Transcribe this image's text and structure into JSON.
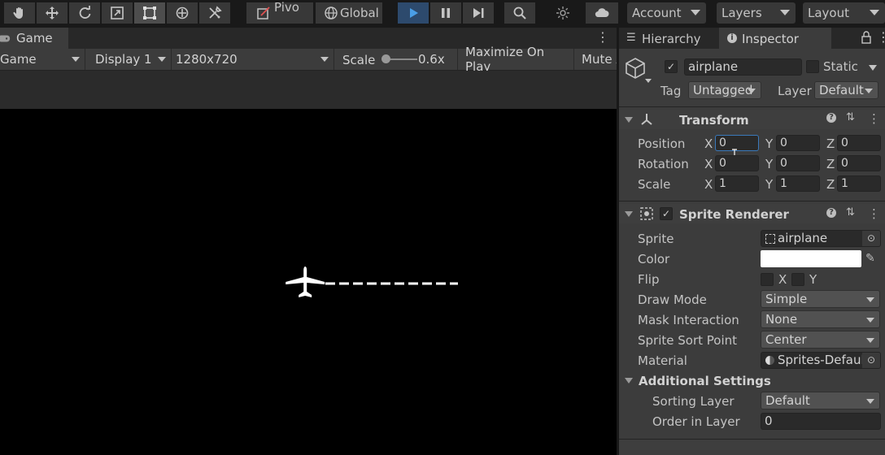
{
  "toolbar": {
    "tools": [
      "hand-tool",
      "move-tool",
      "rotate-tool",
      "scale-tool",
      "rect-tool",
      "transform-tool",
      "custom-tool"
    ],
    "pivot_label": "Pivo",
    "global_label": "Global",
    "account_label": "Account",
    "layers_label": "Layers",
    "layout_label": "Layout"
  },
  "game": {
    "tab_label": "Game",
    "view_mode": "Game",
    "display": "Display 1",
    "resolution": "1280x720",
    "scale_label": "Scale",
    "scale_value": "0.6x",
    "maximize_label": "Maximize On Play",
    "mute_label": "Mute A"
  },
  "inspector": {
    "hierarchy_tab": "Hierarchy",
    "inspector_tab": "Inspector",
    "object_name": "airplane",
    "static_label": "Static",
    "tag_label": "Tag",
    "tag_value": "Untagged",
    "layer_label": "Layer",
    "layer_value": "Default",
    "transform": {
      "title": "Transform",
      "position_label": "Position",
      "rotation_label": "Rotation",
      "scale_label": "Scale",
      "axis_x": "X",
      "axis_y": "Y",
      "axis_z": "Z",
      "position": [
        "0",
        "0",
        "0"
      ],
      "rotation": [
        "0",
        "0",
        "0"
      ],
      "scale": [
        "1",
        "1",
        "1"
      ]
    },
    "sprite_renderer": {
      "title": "Sprite Renderer",
      "sprite_label": "Sprite",
      "sprite_value": "airplane",
      "color_label": "Color",
      "color_value": "#ffffff",
      "flip_label": "Flip",
      "flip_x": "X",
      "flip_y": "Y",
      "draw_mode_label": "Draw Mode",
      "draw_mode_value": "Simple",
      "mask_label": "Mask Interaction",
      "mask_value": "None",
      "sort_point_label": "Sprite Sort Point",
      "sort_point_value": "Center",
      "material_label": "Material",
      "material_value": "Sprites-Defaul",
      "additional_label": "Additional Settings",
      "sorting_layer_label": "Sorting Layer",
      "sorting_layer_value": "Default",
      "order_label": "Order in Layer",
      "order_value": "0"
    }
  },
  "colors": {
    "accent": "#3a79bb",
    "play_bg": "#2d4a6d"
  }
}
